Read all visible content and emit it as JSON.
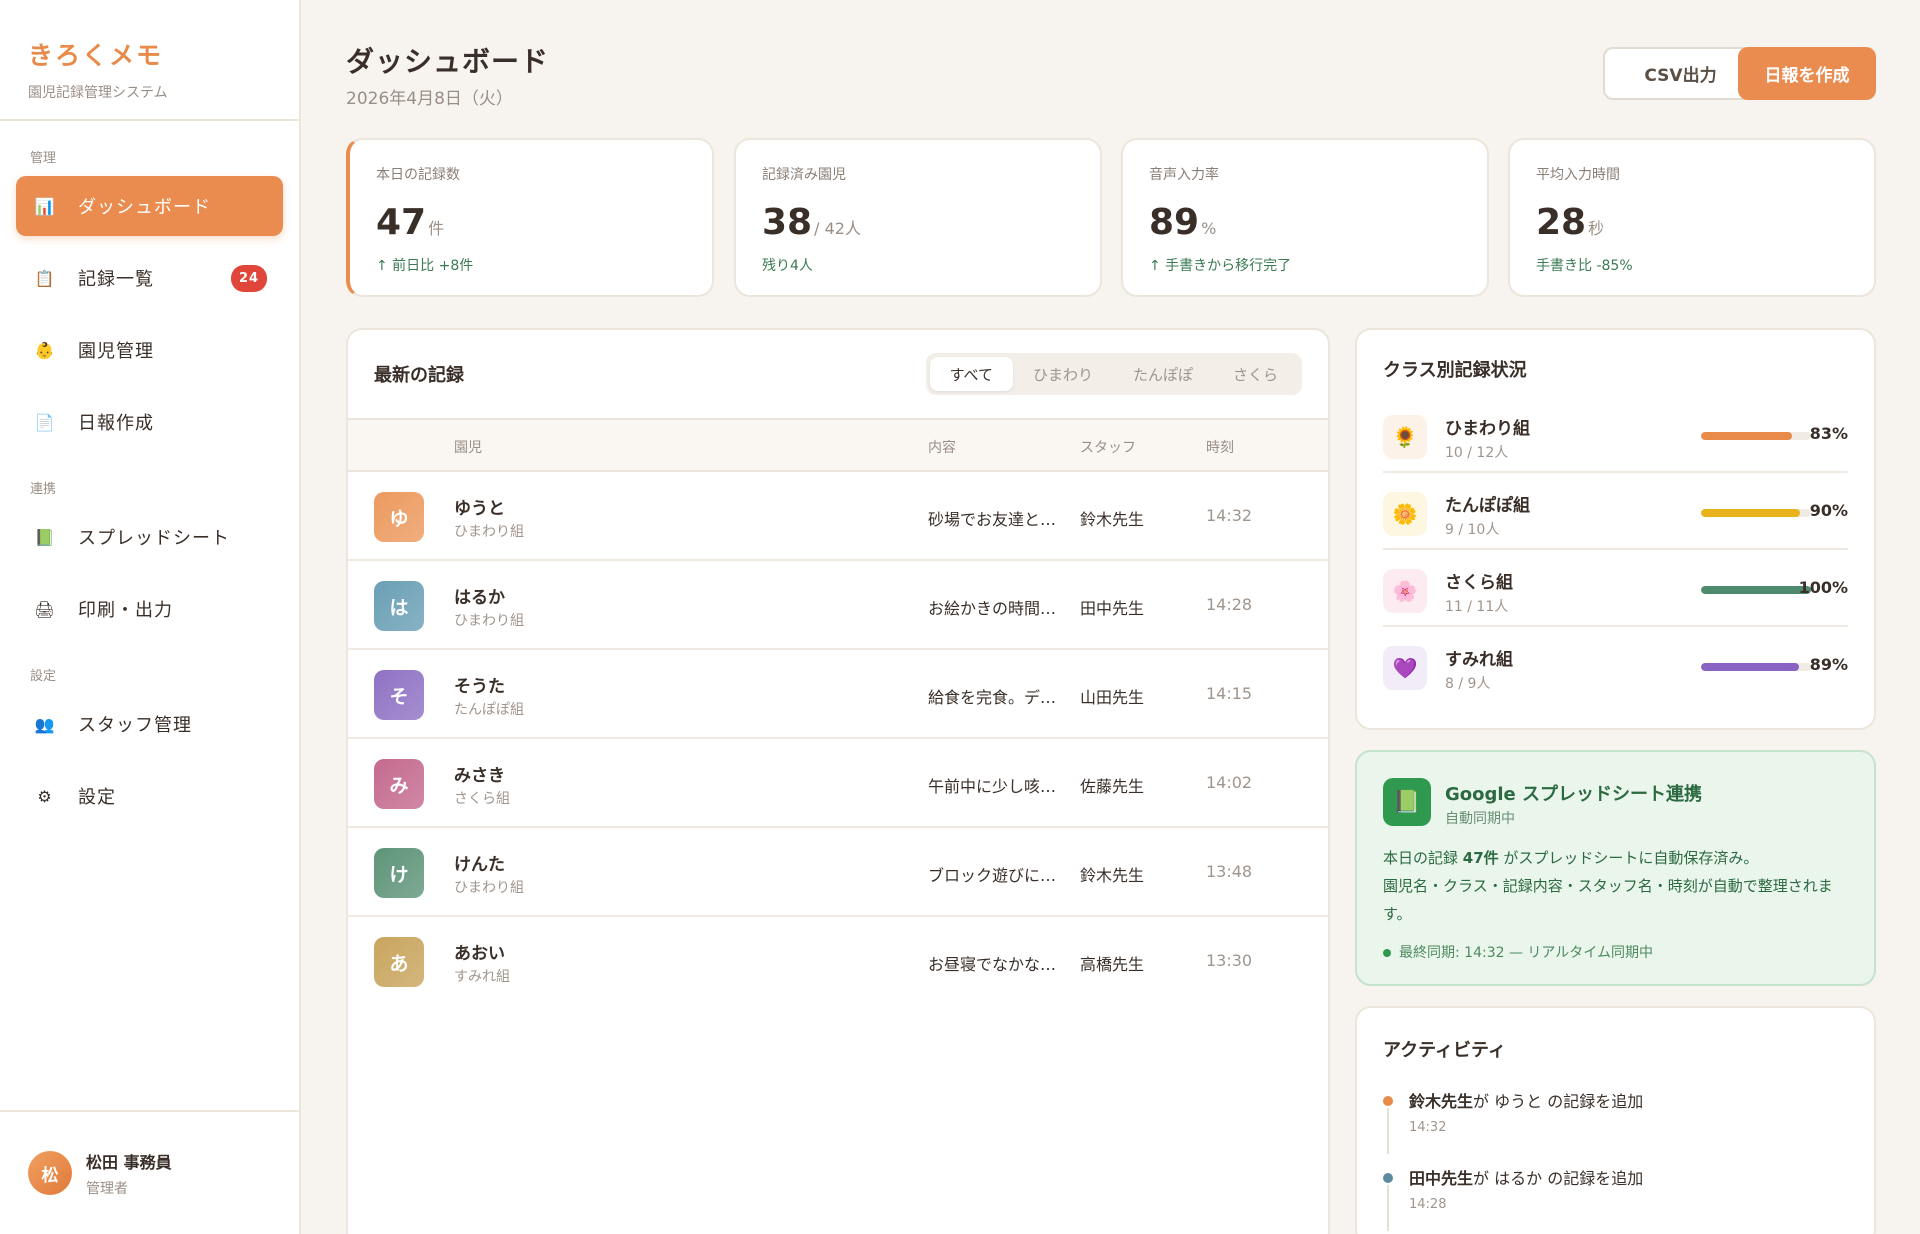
{
  "brand": {
    "title": "きろくメモ",
    "subtitle": "園児記録管理システム"
  },
  "nav": {
    "section_manage": "管理",
    "section_link": "連携",
    "section_settings": "設定",
    "items": [
      {
        "label": "ダッシュボード",
        "icon": "chart-icon",
        "glyph": "📊"
      },
      {
        "label": "記録一覧",
        "icon": "clipboard-icon",
        "glyph": "📋",
        "badge": "24"
      },
      {
        "label": "園児管理",
        "icon": "child-icon",
        "glyph": "👶"
      },
      {
        "label": "日報作成",
        "icon": "document-icon",
        "glyph": "📄"
      },
      {
        "label": "スプレッドシート",
        "icon": "spreadsheet-icon",
        "glyph": "📗"
      },
      {
        "label": "印刷・出力",
        "icon": "printer-icon",
        "glyph": "🖨"
      },
      {
        "label": "スタッフ管理",
        "icon": "staff-icon",
        "glyph": "👥"
      },
      {
        "label": "設定",
        "icon": "gear-icon",
        "glyph": "⚙"
      }
    ]
  },
  "user": {
    "initial": "松",
    "name": "松田 事務員",
    "role": "管理者"
  },
  "header": {
    "title": "ダッシュボード",
    "date": "2026年4月8日（火）",
    "csv_label": "CSV出力",
    "report_label": "日報を作成"
  },
  "stats": [
    {
      "label": "本日の記録数",
      "value": "47",
      "unit": "件",
      "note": "↑ 前日比 +8件"
    },
    {
      "label": "記録済み園児",
      "value": "38",
      "unit": "/ 42人",
      "note": "残り4人"
    },
    {
      "label": "音声入力率",
      "value": "89",
      "unit": "%",
      "note": "↑ 手書きから移行完了"
    },
    {
      "label": "平均入力時間",
      "value": "28",
      "unit": "秒",
      "note": "手書き比 -85%"
    }
  ],
  "records": {
    "title": "最新の記録",
    "tabs": [
      "すべて",
      "ひまわり",
      "たんぽぽ",
      "さくら"
    ],
    "columns": [
      "園児",
      "内容",
      "スタッフ",
      "時刻"
    ],
    "rows": [
      {
        "initial": "ゆ",
        "name": "ゆうと",
        "class": "ひまわり組",
        "content": "砂場でお友達と…",
        "staff": "鈴木先生",
        "time": "14:32",
        "color": "#ec9a5e"
      },
      {
        "initial": "は",
        "name": "はるか",
        "class": "ひまわり組",
        "content": "お絵かきの時間…",
        "staff": "田中先生",
        "time": "14:28",
        "color": "#6a9fb5"
      },
      {
        "initial": "そ",
        "name": "そうた",
        "class": "たんぽぽ組",
        "content": "給食を完食。デ…",
        "staff": "山田先生",
        "time": "14:15",
        "color": "#8f72c4"
      },
      {
        "initial": "み",
        "name": "みさき",
        "class": "さくら組",
        "content": "午前中に少し咳…",
        "staff": "佐藤先生",
        "time": "14:02",
        "color": "#c46a8e"
      },
      {
        "initial": "け",
        "name": "けんた",
        "class": "ひまわり組",
        "content": "ブロック遊びに…",
        "staff": "鈴木先生",
        "time": "13:48",
        "color": "#5e9478"
      },
      {
        "initial": "あ",
        "name": "あおい",
        "class": "すみれ組",
        "content": "お昼寝でなかな…",
        "staff": "高橋先生",
        "time": "13:30",
        "color": "#c9a55e"
      }
    ]
  },
  "classes": {
    "title": "クラス別記録状況",
    "items": [
      {
        "name": "ひまわり組",
        "count": "10 / 12人",
        "pct_label": "83%",
        "fill": 0.83,
        "color": "#e88a4a",
        "icon": "sunflower-icon",
        "glyph": "🌻",
        "bg": "#fdf2e8"
      },
      {
        "name": "たんぽぽ組",
        "count": "9 / 10人",
        "pct_label": "90%",
        "fill": 0.9,
        "color": "#e8b21a",
        "icon": "dandelion-icon",
        "glyph": "🌼",
        "bg": "#fdf7e2"
      },
      {
        "name": "さくら組",
        "count": "11 / 11人",
        "pct_label": "100%",
        "fill": 1.0,
        "color": "#4e8a6e",
        "icon": "sakura-icon",
        "glyph": "🌸",
        "bg": "#fcebf1"
      },
      {
        "name": "すみれ組",
        "count": "8 / 9人",
        "pct_label": "89%",
        "fill": 0.89,
        "color": "#8a62c4",
        "icon": "violet-heart-icon",
        "glyph": "💜",
        "bg": "#f1ecf8"
      }
    ]
  },
  "sync": {
    "title": "Google スプレッドシート連携",
    "subtitle": "自動同期中",
    "line1_prefix": "本日の記録 ",
    "line1_count": "47件",
    "line1_suffix": " がスプレッドシートに自動保存済み。",
    "line2": "園児名・クラス・記録内容・スタッフ名・時刻が自動で整理されます。",
    "status": "最終同期: 14:32 — リアルタイム同期中"
  },
  "activity": {
    "title": "アクティビティ",
    "items": [
      {
        "actor": "鈴木先生",
        "text": "が ゆうと の記録を追加",
        "time": "14:32",
        "color": "#e88a4a"
      },
      {
        "actor": "田中先生",
        "text": "が はるか の記録を追加",
        "time": "14:28",
        "color": "#5e8aa0"
      }
    ]
  }
}
